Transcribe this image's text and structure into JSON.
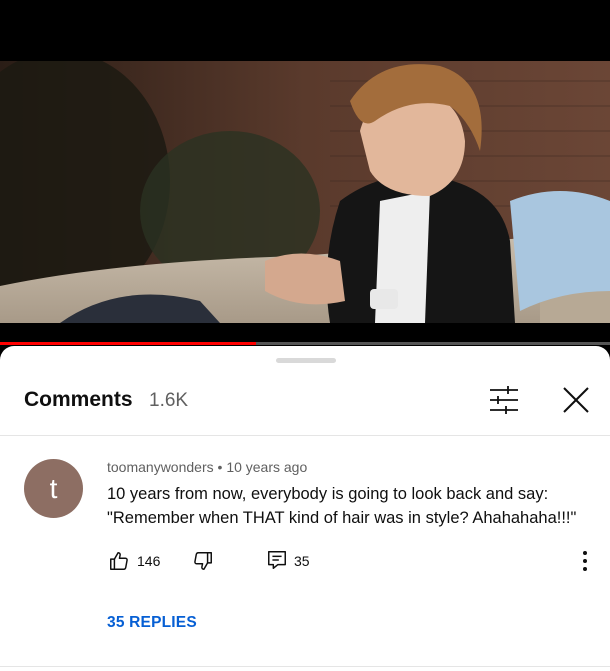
{
  "player": {
    "progress_fraction": 0.42,
    "progress_color": "#ff0000"
  },
  "comments_panel": {
    "title": "Comments",
    "count": "1.6K",
    "filter_icon": "sort-filter-icon",
    "close_icon": "close-icon"
  },
  "comment": {
    "avatar_letter": "t",
    "avatar_color": "#8d6e63",
    "author": "toomanywonders",
    "separator": "•",
    "time": "10 years ago",
    "text_line_1": "10 years from now, everybody is going to look back and say:",
    "text_line_2": "\"Remember when THAT kind of hair was in style? Ahahahaha!!!\"",
    "likes": "146",
    "replies_count": "35",
    "replies_link": "35 REPLIES",
    "like_icon": "thumbs-up-icon",
    "dislike_icon": "thumbs-down-icon",
    "reply_icon": "reply-icon",
    "more_icon": "more-vertical-icon",
    "accent_color": "#065fd4"
  }
}
